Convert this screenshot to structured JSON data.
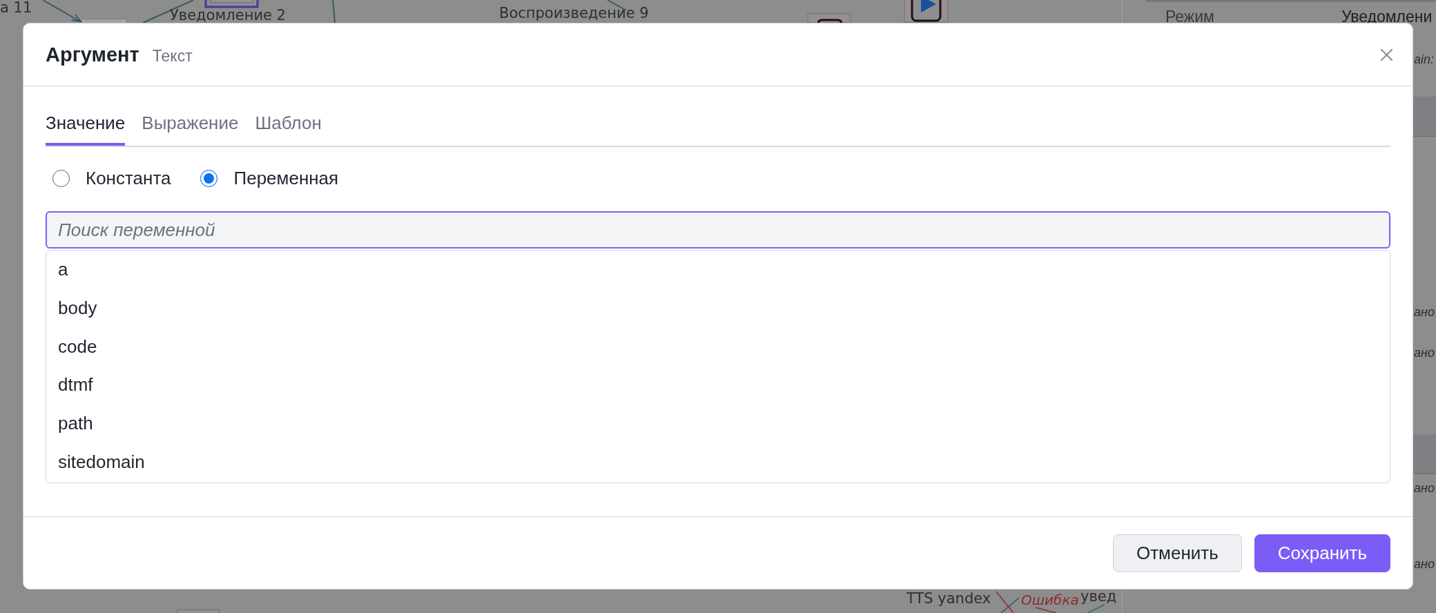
{
  "background_canvas": {
    "labels": [
      {
        "text": "а 11",
        "kind": "node"
      },
      {
        "text": "Уведомление 2",
        "kind": "node"
      },
      {
        "text": "Воспроизведение 9",
        "kind": "node"
      },
      {
        "text": "TTS yandex",
        "kind": "node"
      },
      {
        "text": "Ошибка",
        "kind": "error"
      },
      {
        "text": "увед",
        "kind": "node"
      }
    ]
  },
  "properties_panel": {
    "rows": [
      {
        "kind": "field",
        "label": "Режим",
        "value": "Уведомлени"
      },
      {
        "kind": "note",
        "text": "ain:"
      }
    ],
    "sections": [
      {
        "values": [
          "ано",
          "ано"
        ]
      },
      {
        "values": [
          "ано",
          "ано"
        ]
      }
    ]
  },
  "dialog": {
    "title": "Аргумент",
    "subtitle": "Текст",
    "tabs": [
      {
        "label": "Значение",
        "selected": true
      },
      {
        "label": "Выражение",
        "selected": false
      },
      {
        "label": "Шаблон",
        "selected": false
      }
    ],
    "source_options": [
      {
        "label": "Константа",
        "selected": false
      },
      {
        "label": "Переменная",
        "selected": true
      }
    ],
    "search": {
      "placeholder": "Поиск переменной",
      "focused": true
    },
    "variables": [
      "a",
      "body",
      "code",
      "dtmf",
      "path",
      "sitedomain"
    ],
    "buttons": [
      {
        "label": "Отменить",
        "kind": "secondary"
      },
      {
        "label": "Сохранить",
        "kind": "primary"
      }
    ]
  }
}
